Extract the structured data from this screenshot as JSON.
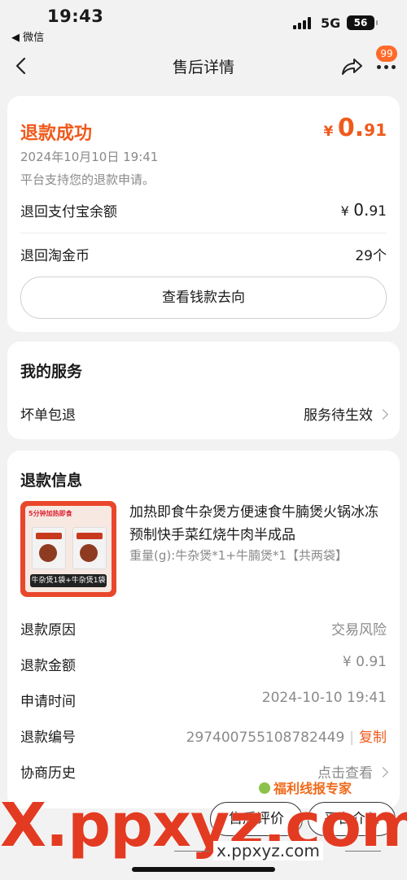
{
  "status_bar": {
    "time": "19:43",
    "back_app": "◀ 微信",
    "network": "5G",
    "battery": "56"
  },
  "navbar": {
    "title": "售后详情",
    "badge": "99"
  },
  "refund": {
    "status": "退款成功",
    "amount_currency": "¥",
    "amount_integer": "0.",
    "amount_decimal": "91",
    "date": "2024年10月10日 19:41",
    "note": "平台支持您的退款申请。",
    "alipay_label": "退回支付宝余额",
    "alipay_currency": "¥",
    "alipay_integer": "0.",
    "alipay_decimal": "91",
    "coins_label": "退回淘金币",
    "coins_value": "29个",
    "track_button": "查看钱款去向"
  },
  "service": {
    "title": "我的服务",
    "item_label": "坏单包退",
    "item_status": "服务待生效"
  },
  "refund_info": {
    "title": "退款信息",
    "product": {
      "name": "加热即食牛杂煲方便速食牛腩煲火锅冰冻预制快手菜红烧牛肉半成品",
      "spec": "重量(g):牛杂煲*1+牛腩煲*1【共两袋】",
      "thumb_top": "5分钟加热即食",
      "thumb_label": "牛杂煲1袋+牛杂煲1袋"
    },
    "reason_label": "退款原因",
    "reason_value": "交易风险",
    "amount_label": "退款金额",
    "amount_value": "¥ 0.91",
    "time_label": "申请时间",
    "time_value": "2024-10-10 19:41",
    "id_label": "退款编号",
    "id_value": "297400755108782449",
    "id_sep": "|",
    "copy_label": "复制",
    "history_label": "协商历史",
    "history_value": "点击查看"
  },
  "bottom_bar": {
    "review_button": "售后评价",
    "platform_button": "平台介入"
  },
  "watermark": {
    "big": "X.ppxyz.com",
    "small": "x.ppxyz.com",
    "brand": "福利线报专家"
  },
  "colors": {
    "accent": "#ef5a1c",
    "watermark_red": "#e33b22",
    "badge": "#ff6a2a"
  }
}
